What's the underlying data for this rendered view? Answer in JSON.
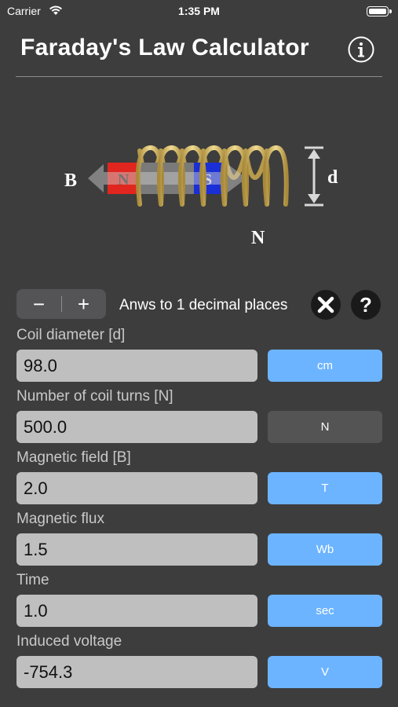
{
  "status_bar": {
    "carrier": "Carrier",
    "time": "1:35 PM"
  },
  "header": {
    "title": "Faraday's Law Calculator"
  },
  "diagram": {
    "label_b": "B",
    "label_d": "d",
    "label_n": "N",
    "magnet_n": "N",
    "magnet_s": "S"
  },
  "controls": {
    "minus": "−",
    "plus": "+",
    "decimals_text": "Anws to 1 decimal places",
    "help": "?"
  },
  "fields": [
    {
      "label": "Coil diameter [d]",
      "value": "98.0",
      "unit": "cm",
      "unit_style": "blue"
    },
    {
      "label": "Number of coil turns [N]",
      "value": "500.0",
      "unit": "N",
      "unit_style": "gray"
    },
    {
      "label": "Magnetic field [B]",
      "value": "2.0",
      "unit": "T",
      "unit_style": "blue"
    },
    {
      "label": "Magnetic flux",
      "value": "1.5",
      "unit": "Wb",
      "unit_style": "blue"
    },
    {
      "label": "Time",
      "value": "1.0",
      "unit": "sec",
      "unit_style": "blue"
    },
    {
      "label": "Induced voltage",
      "value": "-754.3",
      "unit": "V",
      "unit_style": "blue"
    }
  ],
  "colors": {
    "background": "#3d3d3d",
    "accent_blue": "#6cb4ff",
    "field_bg": "#bfbfbf",
    "coil_gold": "#e2c774",
    "magnet_red": "#e0261e",
    "magnet_blue": "#1a2fd6"
  }
}
